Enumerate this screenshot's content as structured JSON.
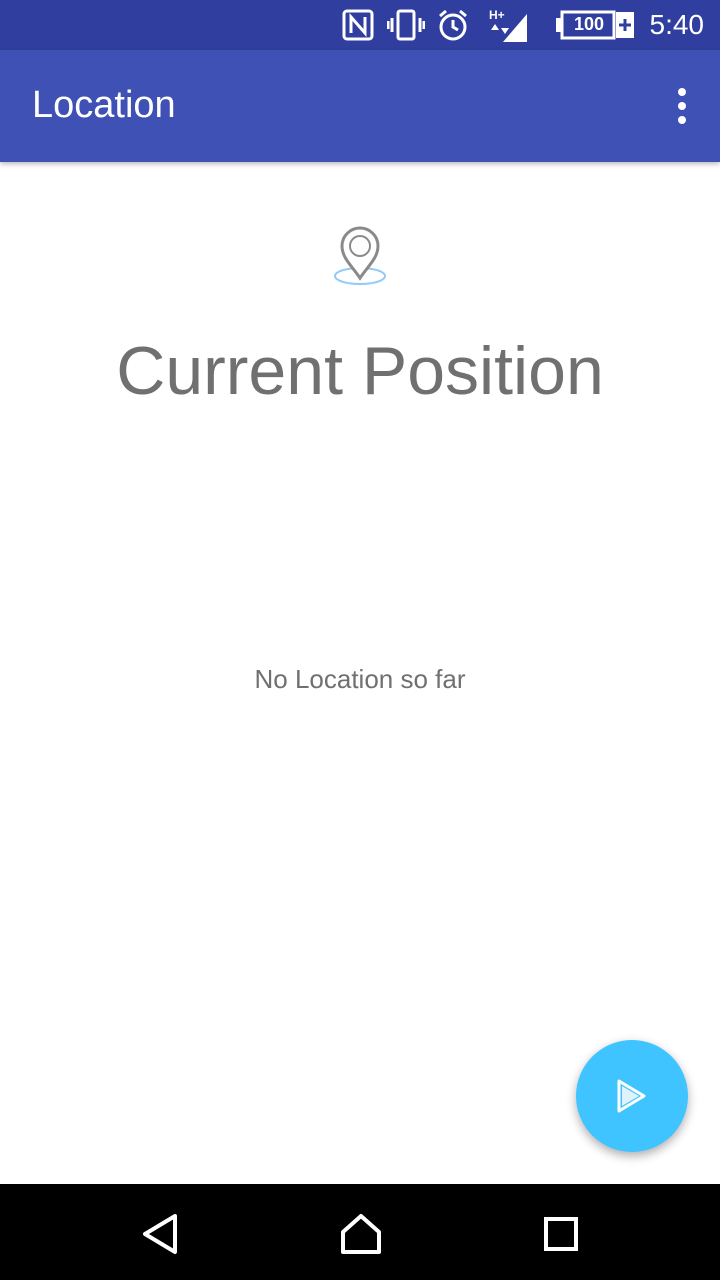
{
  "status_bar": {
    "time": "5:40",
    "battery_level": "100",
    "icons": [
      "nfc-icon",
      "vibrate-icon",
      "alarm-icon",
      "signal-icon",
      "battery-icon"
    ],
    "network_label": "H+"
  },
  "app_bar": {
    "title": "Location",
    "menu_icon": "overflow-menu-icon"
  },
  "main": {
    "icon": "location-pin-icon",
    "heading": "Current Position",
    "empty_message": "No Location so far"
  },
  "fab": {
    "icon": "play-icon",
    "color": "#40c4ff"
  },
  "nav_bar": {
    "icons": [
      "back-icon",
      "home-icon",
      "recents-icon"
    ]
  },
  "colors": {
    "status_bar": "#303f9f",
    "app_bar": "#3f51b5",
    "text_gray": "#707070"
  }
}
